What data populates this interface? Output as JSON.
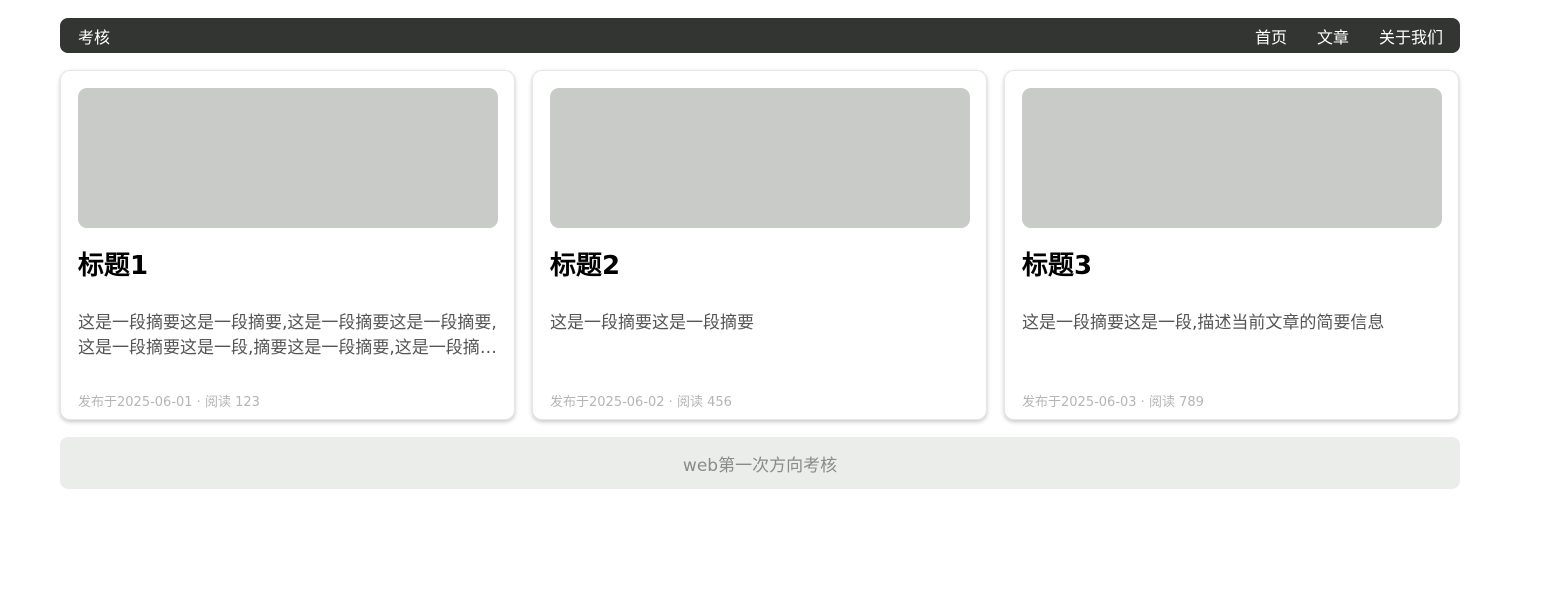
{
  "header": {
    "brand": "考核",
    "nav": [
      "首页",
      "文章",
      "关于我们"
    ]
  },
  "cards": [
    {
      "title": "标题1",
      "summary": "这是一段摘要这是一段摘要,这是一段摘要这是一段摘要,这是一段摘要这是一段,摘要这是一段摘要,这是一段摘要这是一段摘要",
      "meta": "发布于2025-06-01 · 阅读 123"
    },
    {
      "title": "标题2",
      "summary": "这是一段摘要这是一段摘要",
      "meta": "发布于2025-06-02 · 阅读 456"
    },
    {
      "title": "标题3",
      "summary": "这是一段摘要这是一段,描述当前文章的简要信息",
      "meta": "发布于2025-06-03 · 阅读 789"
    }
  ],
  "footer": {
    "text": "web第一次方向考核"
  },
  "colors": {
    "navbar_bg": "#333532",
    "thumb_bg": "#c9cbc8",
    "footer_bg": "#ebedeb"
  }
}
